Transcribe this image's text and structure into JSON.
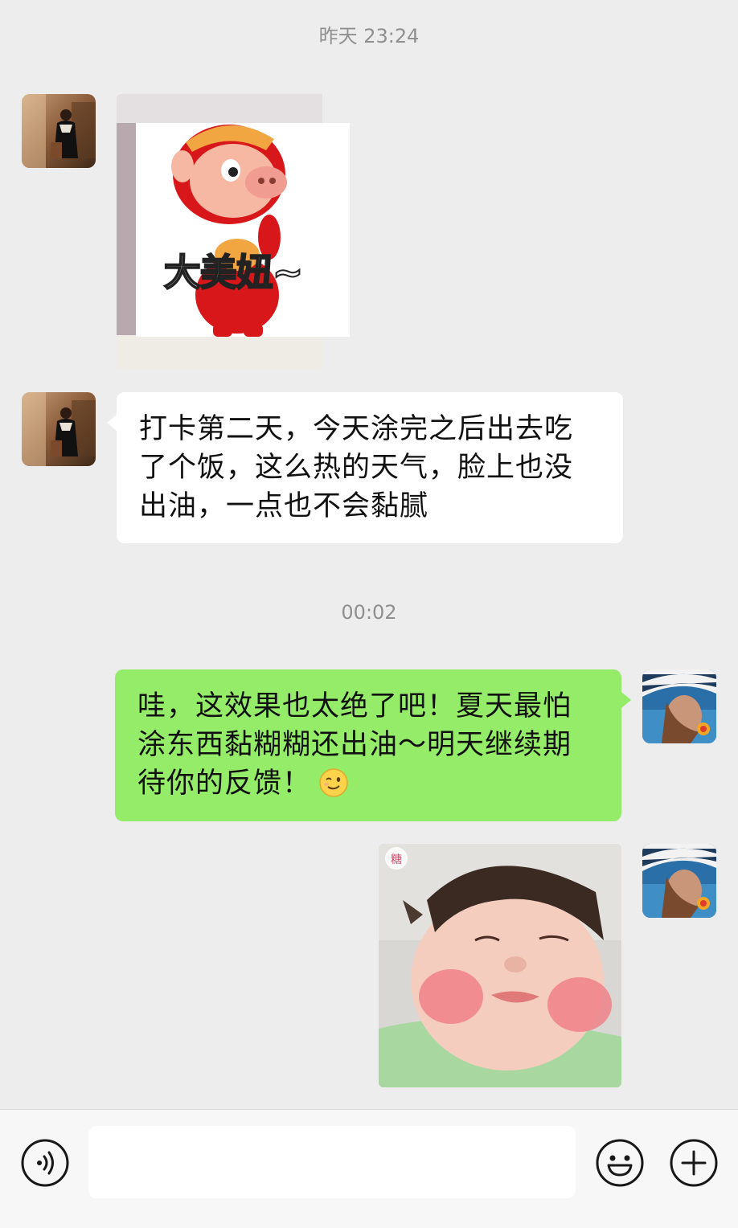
{
  "conversation": {
    "messages": [
      {
        "type": "timestamp",
        "text": "昨天 23:24"
      },
      {
        "type": "image",
        "side": "left",
        "sender": "contact",
        "sticker_caption": "大美妞~"
      },
      {
        "type": "text",
        "side": "left",
        "sender": "contact",
        "text": "打卡第二天，今天涂完之后出去吃了个饭，这么热的天气，脸上也没出油，一点也不会黏腻"
      },
      {
        "type": "timestamp",
        "text": "00:02"
      },
      {
        "type": "text",
        "side": "right",
        "sender": "me",
        "text": "哇，这效果也太绝了吧！夏天最怕涂东西黏糊糊还出油～明天继续期待你的反馈！",
        "emoji": "wink-emoji"
      },
      {
        "type": "image",
        "side": "right",
        "sender": "me",
        "watermark": "糖"
      }
    ]
  },
  "input_bar": {
    "voice_icon": "voice-icon",
    "text_value": "",
    "emoji_icon": "smiley-icon",
    "more_icon": "plus-icon"
  },
  "colors": {
    "background": "#ededed",
    "incoming_bubble": "#ffffff",
    "outgoing_bubble": "#95ec69",
    "timestamp": "#8f8f8f",
    "input_bar": "#f7f7f7"
  }
}
